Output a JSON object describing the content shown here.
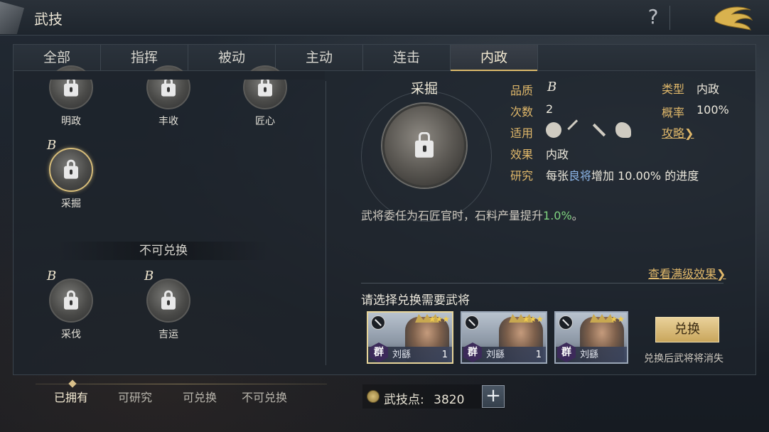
{
  "header": {
    "title": "武技",
    "help_icon": "?"
  },
  "tabs": [
    {
      "label": "全部"
    },
    {
      "label": "指挥"
    },
    {
      "label": "被动"
    },
    {
      "label": "主动"
    },
    {
      "label": "连击"
    },
    {
      "label": "内政",
      "active": true
    }
  ],
  "skills_owned": [
    {
      "name": "明政"
    },
    {
      "name": "丰收"
    },
    {
      "name": "匠心"
    },
    {
      "name": "采掘",
      "grade": "B",
      "selected": true
    }
  ],
  "non_exchangeable": {
    "section_label": "不可兑换",
    "skills": [
      {
        "name": "采伐",
        "grade": "B"
      },
      {
        "name": "吉运",
        "grade": "B"
      }
    ]
  },
  "filters": [
    {
      "label": "已拥有",
      "active": true
    },
    {
      "label": "可研究"
    },
    {
      "label": "可兑换"
    },
    {
      "label": "不可兑换"
    }
  ],
  "points": {
    "label": "武技点:",
    "value": "3820",
    "plus": "+"
  },
  "detail": {
    "name": "采掘",
    "quality_label": "品质",
    "quality_value": "B",
    "count_label": "次数",
    "count_value": "2",
    "apply_label": "适用",
    "apply_units": [
      "shield-unit-icon",
      "bow-unit-icon",
      "spear-unit-icon",
      "horse-unit-icon"
    ],
    "effect_label": "效果",
    "effect_value": "内政",
    "research_label": "研究",
    "research_prefix": "每张",
    "research_highlight": "良将",
    "research_suffix": "增加 10.00% 的进度",
    "type_label": "类型",
    "type_value": "内政",
    "chance_label": "概率",
    "chance_value": "100%",
    "guide_link": "攻略❯",
    "description_prefix": "武将委任为石匠官时，石料产量提升",
    "description_highlight": "1.0%",
    "description_suffix": "。",
    "full_effect_link": "查看满级效果❯"
  },
  "exchange": {
    "title": "请选择兑换需要武将",
    "cards": [
      {
        "faction": "群",
        "name": "刘繇",
        "count": "1",
        "stars": "★★★",
        "selected": true
      },
      {
        "faction": "群",
        "name": "刘繇",
        "count": "1",
        "stars": "★★★"
      },
      {
        "faction": "群",
        "name": "刘繇",
        "count": "",
        "stars": "★★"
      }
    ],
    "button_label": "兑换",
    "note": "兑换后武将将消失"
  },
  "colors": {
    "gold": "#e0b86a",
    "highlight_blue": "#8db6e8",
    "highlight_green": "#7fd47f"
  }
}
